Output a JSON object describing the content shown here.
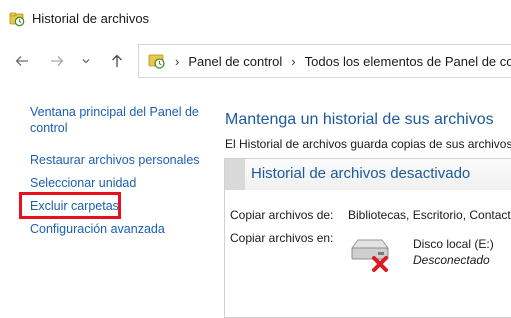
{
  "window": {
    "title": "Historial de archivos",
    "icon": "file-history-icon"
  },
  "nav": {
    "back_icon": "arrow-left-icon",
    "forward_icon": "arrow-right-icon",
    "recent_icon": "chevron-down-icon",
    "up_icon": "arrow-up-icon"
  },
  "breadcrumb": {
    "icon": "control-panel-icon",
    "items": [
      "Panel de control",
      "Todos los elementos de Panel de control"
    ]
  },
  "sidebar": {
    "home_link": "Ventana principal del Panel de control",
    "links": [
      "Restaurar archivos personales",
      "Seleccionar unidad",
      "Excluir carpetas",
      "Configuración avanzada"
    ],
    "highlight_color": "#e8101e"
  },
  "main": {
    "heading": "Mantenga un historial de sus archivos",
    "description": "El Historial de archivos guarda copias de sus archivos par",
    "status_panel": {
      "title": "Historial de archivos desactivado",
      "copy_from_label": "Copiar archivos de:",
      "copy_from_value": "Bibliotecas, Escritorio, Contactos",
      "copy_to_label": "Copiar archivos en:",
      "drive_name": "Disco local (E:)",
      "drive_status": "Desconectado",
      "drive_icon": "disconnected-drive-icon"
    }
  },
  "colors": {
    "link": "#1a5fb4",
    "heading": "#1b5a9c"
  }
}
